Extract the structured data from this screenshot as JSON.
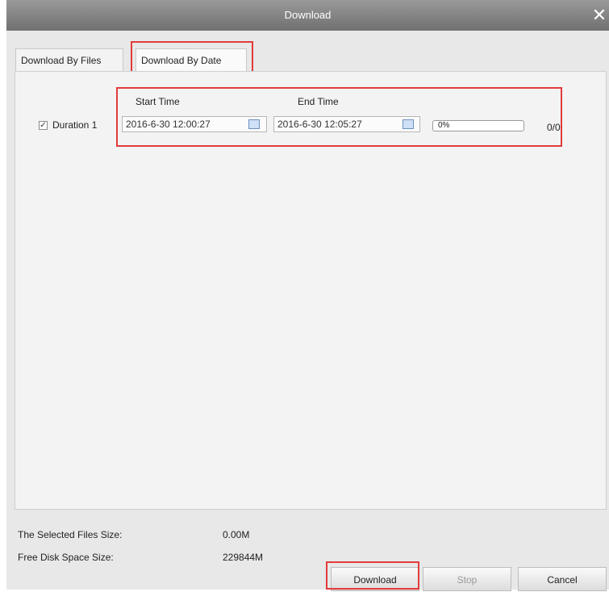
{
  "window": {
    "title": "Download",
    "close_glyph": "✕"
  },
  "tabs": [
    {
      "label": "Download By Files"
    },
    {
      "label": "Download By Date",
      "active": true
    }
  ],
  "table": {
    "start_header": "Start Time",
    "end_header": "End Time"
  },
  "rows": [
    {
      "checked": true,
      "checkbox_glyph": "✓",
      "label": "Duration 1",
      "start": "2016-6-30 12:00:27",
      "end": "2016-6-30 12:05:27",
      "progress_percent": 0,
      "progress_text": "0%",
      "count": "0/0"
    }
  ],
  "footer": {
    "selected_label": "The Selected Files Size:",
    "selected_value": "0.00M",
    "free_label": "Free Disk Space Size:",
    "free_value": "229844M"
  },
  "buttons": {
    "download": "Download",
    "stop": "Stop",
    "cancel": "Cancel"
  },
  "icons": {
    "calendar": "calendar-icon",
    "close": "close-icon",
    "check": "check-icon"
  },
  "colors": {
    "highlight": "#e23b3b",
    "titlebar": "#808080",
    "progress_fill": "#4caf50"
  }
}
